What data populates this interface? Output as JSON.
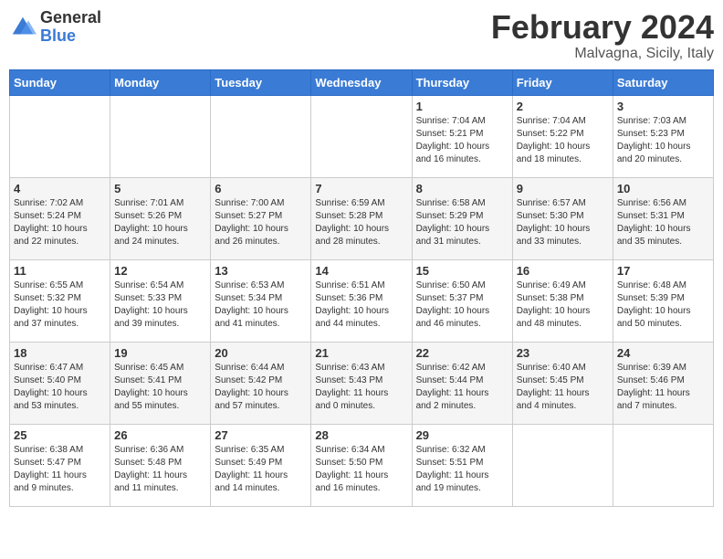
{
  "logo": {
    "general": "General",
    "blue": "Blue"
  },
  "calendar": {
    "title": "February 2024",
    "subtitle": "Malvagna, Sicily, Italy"
  },
  "headers": [
    "Sunday",
    "Monday",
    "Tuesday",
    "Wednesday",
    "Thursday",
    "Friday",
    "Saturday"
  ],
  "weeks": [
    [
      {
        "day": "",
        "info": ""
      },
      {
        "day": "",
        "info": ""
      },
      {
        "day": "",
        "info": ""
      },
      {
        "day": "",
        "info": ""
      },
      {
        "day": "1",
        "info": "Sunrise: 7:04 AM\nSunset: 5:21 PM\nDaylight: 10 hours\nand 16 minutes."
      },
      {
        "day": "2",
        "info": "Sunrise: 7:04 AM\nSunset: 5:22 PM\nDaylight: 10 hours\nand 18 minutes."
      },
      {
        "day": "3",
        "info": "Sunrise: 7:03 AM\nSunset: 5:23 PM\nDaylight: 10 hours\nand 20 minutes."
      }
    ],
    [
      {
        "day": "4",
        "info": "Sunrise: 7:02 AM\nSunset: 5:24 PM\nDaylight: 10 hours\nand 22 minutes."
      },
      {
        "day": "5",
        "info": "Sunrise: 7:01 AM\nSunset: 5:26 PM\nDaylight: 10 hours\nand 24 minutes."
      },
      {
        "day": "6",
        "info": "Sunrise: 7:00 AM\nSunset: 5:27 PM\nDaylight: 10 hours\nand 26 minutes."
      },
      {
        "day": "7",
        "info": "Sunrise: 6:59 AM\nSunset: 5:28 PM\nDaylight: 10 hours\nand 28 minutes."
      },
      {
        "day": "8",
        "info": "Sunrise: 6:58 AM\nSunset: 5:29 PM\nDaylight: 10 hours\nand 31 minutes."
      },
      {
        "day": "9",
        "info": "Sunrise: 6:57 AM\nSunset: 5:30 PM\nDaylight: 10 hours\nand 33 minutes."
      },
      {
        "day": "10",
        "info": "Sunrise: 6:56 AM\nSunset: 5:31 PM\nDaylight: 10 hours\nand 35 minutes."
      }
    ],
    [
      {
        "day": "11",
        "info": "Sunrise: 6:55 AM\nSunset: 5:32 PM\nDaylight: 10 hours\nand 37 minutes."
      },
      {
        "day": "12",
        "info": "Sunrise: 6:54 AM\nSunset: 5:33 PM\nDaylight: 10 hours\nand 39 minutes."
      },
      {
        "day": "13",
        "info": "Sunrise: 6:53 AM\nSunset: 5:34 PM\nDaylight: 10 hours\nand 41 minutes."
      },
      {
        "day": "14",
        "info": "Sunrise: 6:51 AM\nSunset: 5:36 PM\nDaylight: 10 hours\nand 44 minutes."
      },
      {
        "day": "15",
        "info": "Sunrise: 6:50 AM\nSunset: 5:37 PM\nDaylight: 10 hours\nand 46 minutes."
      },
      {
        "day": "16",
        "info": "Sunrise: 6:49 AM\nSunset: 5:38 PM\nDaylight: 10 hours\nand 48 minutes."
      },
      {
        "day": "17",
        "info": "Sunrise: 6:48 AM\nSunset: 5:39 PM\nDaylight: 10 hours\nand 50 minutes."
      }
    ],
    [
      {
        "day": "18",
        "info": "Sunrise: 6:47 AM\nSunset: 5:40 PM\nDaylight: 10 hours\nand 53 minutes."
      },
      {
        "day": "19",
        "info": "Sunrise: 6:45 AM\nSunset: 5:41 PM\nDaylight: 10 hours\nand 55 minutes."
      },
      {
        "day": "20",
        "info": "Sunrise: 6:44 AM\nSunset: 5:42 PM\nDaylight: 10 hours\nand 57 minutes."
      },
      {
        "day": "21",
        "info": "Sunrise: 6:43 AM\nSunset: 5:43 PM\nDaylight: 11 hours\nand 0 minutes."
      },
      {
        "day": "22",
        "info": "Sunrise: 6:42 AM\nSunset: 5:44 PM\nDaylight: 11 hours\nand 2 minutes."
      },
      {
        "day": "23",
        "info": "Sunrise: 6:40 AM\nSunset: 5:45 PM\nDaylight: 11 hours\nand 4 minutes."
      },
      {
        "day": "24",
        "info": "Sunrise: 6:39 AM\nSunset: 5:46 PM\nDaylight: 11 hours\nand 7 minutes."
      }
    ],
    [
      {
        "day": "25",
        "info": "Sunrise: 6:38 AM\nSunset: 5:47 PM\nDaylight: 11 hours\nand 9 minutes."
      },
      {
        "day": "26",
        "info": "Sunrise: 6:36 AM\nSunset: 5:48 PM\nDaylight: 11 hours\nand 11 minutes."
      },
      {
        "day": "27",
        "info": "Sunrise: 6:35 AM\nSunset: 5:49 PM\nDaylight: 11 hours\nand 14 minutes."
      },
      {
        "day": "28",
        "info": "Sunrise: 6:34 AM\nSunset: 5:50 PM\nDaylight: 11 hours\nand 16 minutes."
      },
      {
        "day": "29",
        "info": "Sunrise: 6:32 AM\nSunset: 5:51 PM\nDaylight: 11 hours\nand 19 minutes."
      },
      {
        "day": "",
        "info": ""
      },
      {
        "day": "",
        "info": ""
      }
    ]
  ]
}
